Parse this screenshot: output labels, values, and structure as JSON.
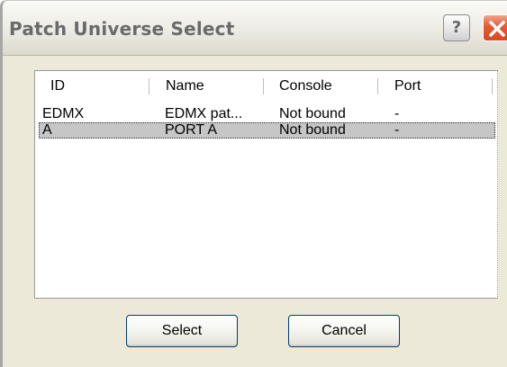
{
  "window": {
    "title": "Patch Universe Select",
    "help_label": "?"
  },
  "list": {
    "columns": [
      "ID",
      "Name",
      "Console",
      "Port"
    ],
    "rows": [
      {
        "id": "EDMX",
        "name": "EDMX pat...",
        "console": "Not bound",
        "port": "-",
        "selected": false
      },
      {
        "id": "A",
        "name": "PORT A",
        "console": "Not bound",
        "port": "-",
        "selected": true
      }
    ]
  },
  "buttons": {
    "select_label": "Select",
    "cancel_label": "Cancel"
  },
  "colors": {
    "dialog_background": "#ece9d8",
    "close_button": "#e25a31",
    "selected_row": "#c6c6c6"
  },
  "icons": {
    "close": "close-icon",
    "help": "help-icon"
  }
}
